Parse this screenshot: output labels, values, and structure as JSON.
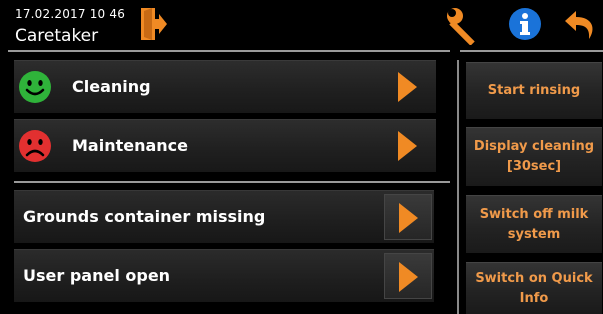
{
  "header": {
    "datetime": "17.02.2017 10 46",
    "user": "Caretaker",
    "icons": [
      "logout-icon",
      "wrench-icon",
      "info-icon",
      "back-icon"
    ]
  },
  "status_items": [
    {
      "label": "Cleaning",
      "mood": "happy",
      "icon": "smiley-happy-icon",
      "color": "#2fb33a"
    },
    {
      "label": "Maintenance",
      "mood": "sad",
      "icon": "smiley-sad-icon",
      "color": "#e23030"
    }
  ],
  "messages": [
    {
      "label": "Grounds container missing"
    },
    {
      "label": "User panel open"
    }
  ],
  "actions": [
    {
      "label": "Start rinsing"
    },
    {
      "label": "Display cleaning [30sec]"
    },
    {
      "label": "Switch off milk system"
    },
    {
      "label": "Switch on Quick Info"
    }
  ],
  "colors": {
    "accent": "#f08a24",
    "action_text": "#f09a4a",
    "info_blue": "#1a73d9",
    "background": "#000000"
  }
}
